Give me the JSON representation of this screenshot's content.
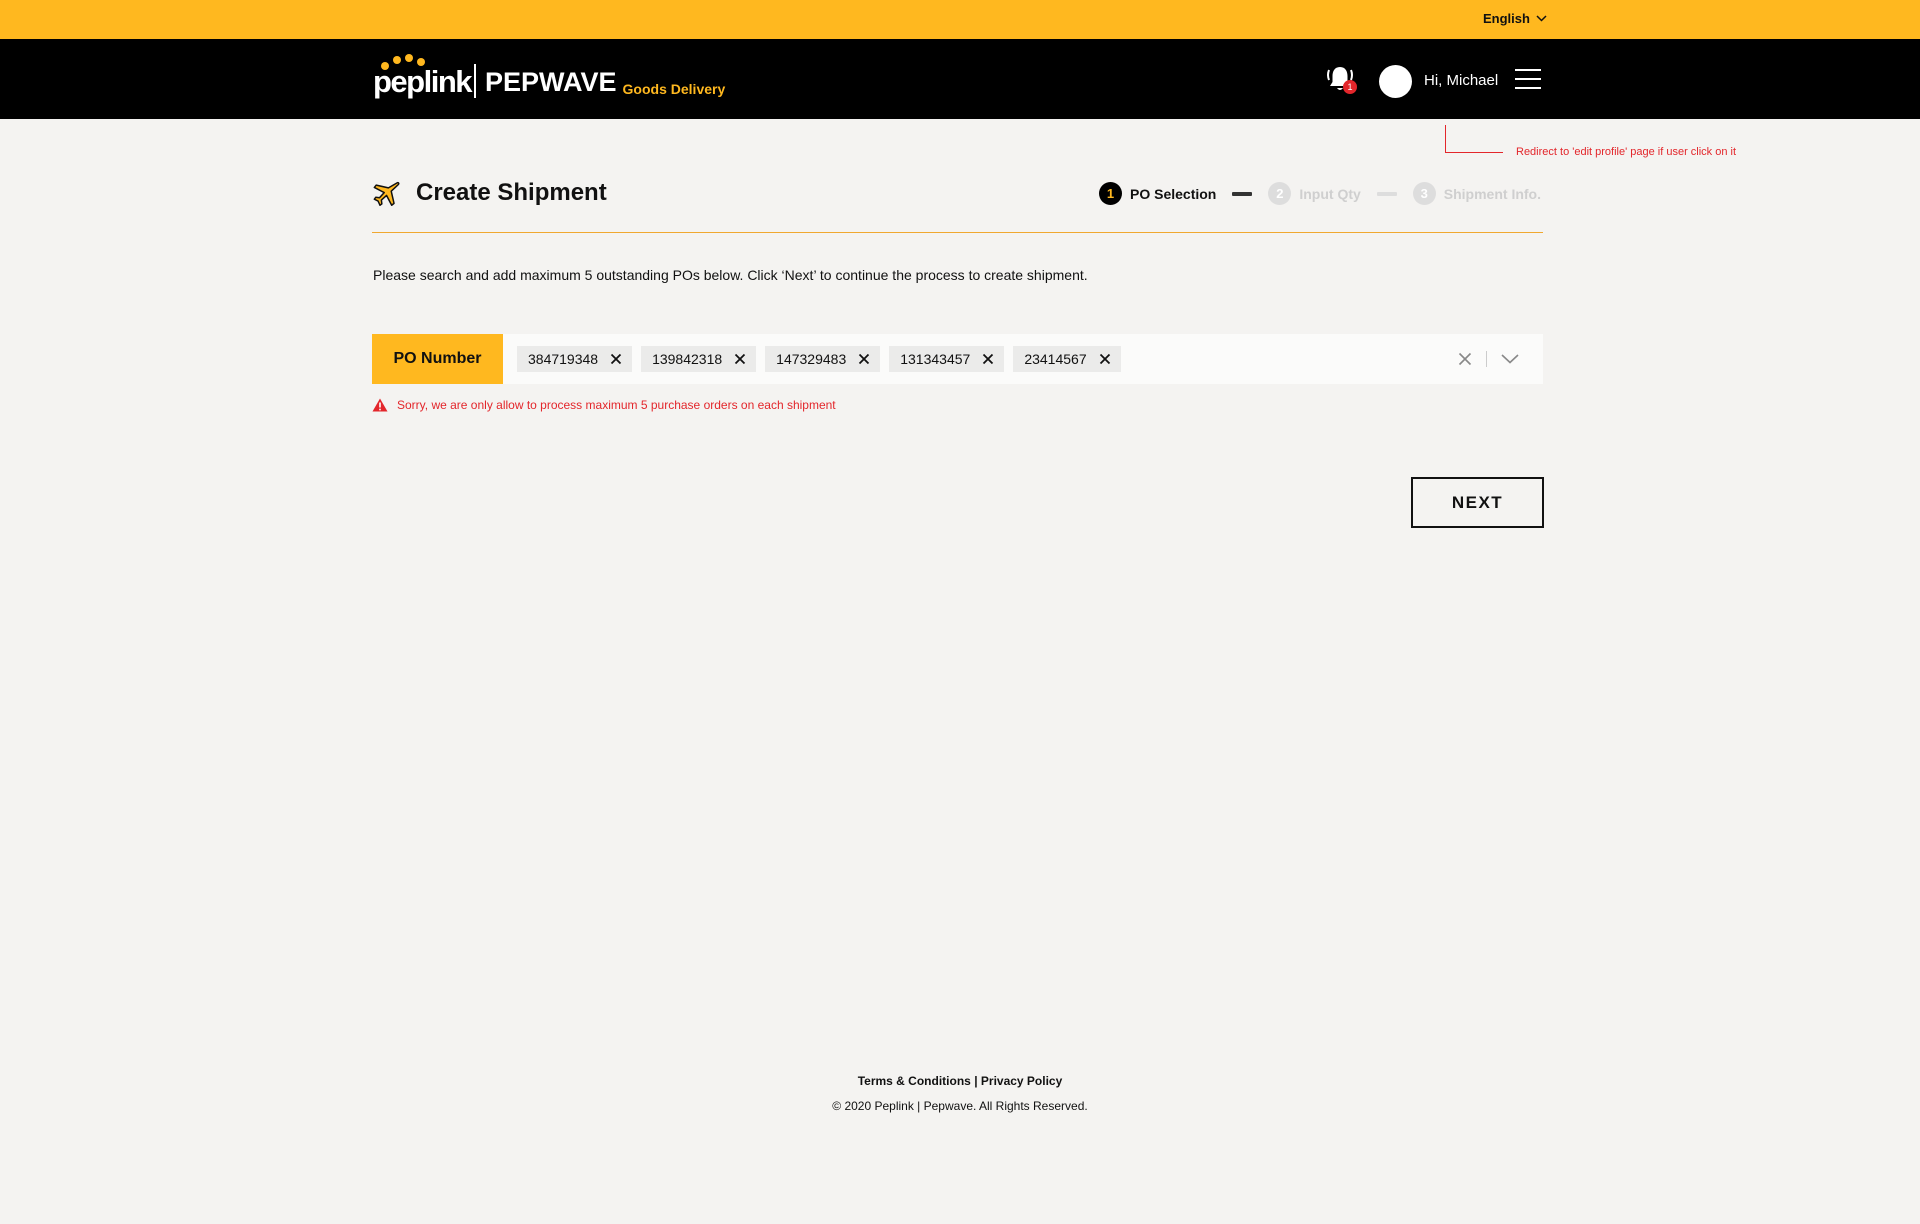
{
  "topbar": {
    "language": "English"
  },
  "header": {
    "logo_peplink": "peplink",
    "logo_pepwave": "PEPWAVE",
    "logo_tagline": "Goods Delivery",
    "notification_count": "1",
    "greeting": "Hi, Michael"
  },
  "annotation": "Redirect to 'edit profile' page if user click on it",
  "page": {
    "title": "Create Shipment",
    "steps": [
      {
        "num": "1",
        "label": "PO Selection"
      },
      {
        "num": "2",
        "label": "Input Qty"
      },
      {
        "num": "3",
        "label": "Shipment Info."
      }
    ],
    "instruction": "Please search and add maximum 5 outstanding POs below. Click ‘Next’ to continue the process to create shipment.",
    "po_label": "PO Number",
    "po_chips": [
      "384719348",
      "139842318",
      "147329483",
      "131343457",
      "23414567"
    ],
    "error": "Sorry, we are only allow to process maximum 5 purchase orders on each shipment",
    "next_label": "NEXT"
  },
  "footer": {
    "terms": "Terms & Conditions",
    "separator": "|",
    "privacy": "Privacy Policy",
    "copyright": "© 2020 Peplink | Pepwave. All Rights Reserved."
  },
  "colors": {
    "brand_yellow": "#ffb81f",
    "error_red": "#e3262b",
    "header_black": "#000000"
  }
}
